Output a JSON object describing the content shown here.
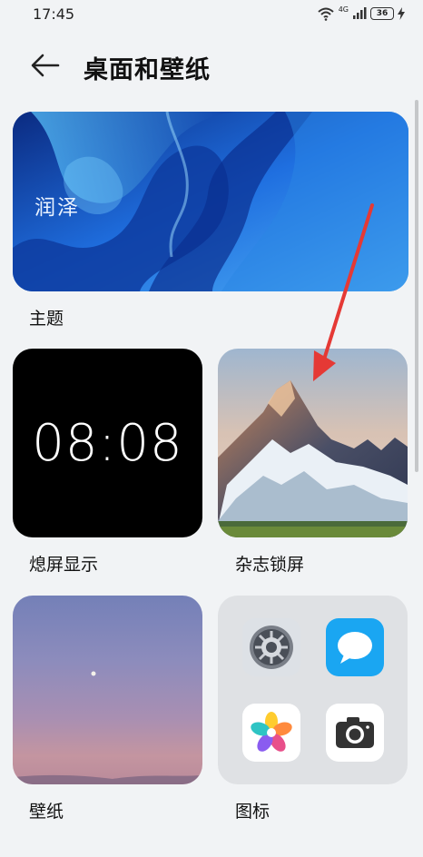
{
  "status_bar": {
    "time": "17:45",
    "network": "4G",
    "battery": "36"
  },
  "header": {
    "title": "桌面和壁纸"
  },
  "cards": {
    "theme": {
      "label": "主题",
      "theme_name": "润泽"
    },
    "aod": {
      "label": "熄屏显示",
      "clock": "08:08"
    },
    "magazine": {
      "label": "杂志锁屏"
    },
    "wallpaper": {
      "label": "壁纸"
    },
    "icons": {
      "label": "图标"
    }
  },
  "colors": {
    "background": "#f1f3f5",
    "annotation_arrow": "#e53935"
  },
  "icons": [
    "back-arrow-icon",
    "wifi-icon",
    "signal-icon",
    "battery-icon",
    "charging-icon",
    "settings-gear-icon",
    "messages-icon",
    "gallery-flower-icon",
    "camera-icon"
  ]
}
